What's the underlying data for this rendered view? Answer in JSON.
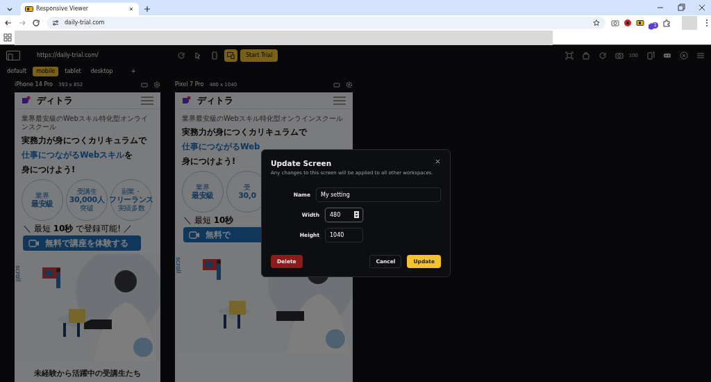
{
  "browser": {
    "tab_title": "Responsive Viewer",
    "url": "daily-trial.com",
    "extension_badge": "1"
  },
  "toolbar": {
    "url": "https://daily-trial.com/",
    "trial_button": "Start Trial",
    "zoom": "100"
  },
  "workspaces": [
    {
      "label": "default",
      "selected": false
    },
    {
      "label": "mobile",
      "selected": true
    },
    {
      "label": "tablet",
      "selected": false
    },
    {
      "label": "desktop",
      "selected": false
    },
    {
      "label": "+",
      "selected": false
    }
  ],
  "devices": [
    {
      "name": "iPhone 14 Pro",
      "size": "393 x 852",
      "page": {
        "logo": "ディトラ",
        "tagline": "業界最安級のWebスキル特化型オンラインスクール",
        "headline": [
          [
            {
              "text": "実務力が身につくカリキュラムで",
              "accent": false
            }
          ],
          [
            {
              "text": "仕事につながるWebスキル",
              "accent": true
            },
            {
              "text": "を",
              "accent": false
            }
          ],
          [
            {
              "text": "身につけよう!",
              "accent": false
            }
          ]
        ],
        "badges": [
          [
            "業界",
            "最安級"
          ],
          [
            "受講生",
            "30,000人",
            "突破"
          ],
          [
            "副業・",
            "フリーランス",
            "実績多数"
          ]
        ],
        "note": "＼ 最短 **10秒** で登録可能! ／",
        "cta": "無料で講座を体験する",
        "scroll": "scroll",
        "section_title": "未経験から活躍中の受講生たち"
      }
    },
    {
      "name": "Pixel 7 Pro",
      "size": "480 x 1040",
      "page": {
        "logo": "ディトラ",
        "tagline": "業界最安級のWebスキル特化型オンラインスクール",
        "headline": [
          [
            {
              "text": "実務力が身につくカリキュラムで",
              "accent": false
            }
          ],
          [
            {
              "text": "仕事につながるWeb",
              "accent": true
            }
          ],
          [
            {
              "text": "身につけよう!",
              "accent": false
            }
          ]
        ],
        "badges": [
          [
            "業界",
            "最安級"
          ],
          [
            "受",
            "30,0"
          ]
        ],
        "note": "＼ 最短 **10秒**",
        "cta": "無料で",
        "scroll": "scroll"
      }
    }
  ],
  "dialog": {
    "title": "Update Screen",
    "subtitle": "Any changes to this screen will be applied to all other workspaces.",
    "fields": [
      {
        "label": "Name",
        "value": "My setting",
        "kind": "text",
        "focused": false
      },
      {
        "label": "Width",
        "value": "480",
        "kind": "number",
        "focused": true
      },
      {
        "label": "Height",
        "value": "1040",
        "kind": "number",
        "focused": false
      }
    ],
    "buttons": [
      {
        "label": "Delete",
        "kind": "danger"
      },
      {
        "label": "Cancel",
        "kind": "secondary"
      },
      {
        "label": "Update",
        "kind": "primary"
      }
    ]
  }
}
